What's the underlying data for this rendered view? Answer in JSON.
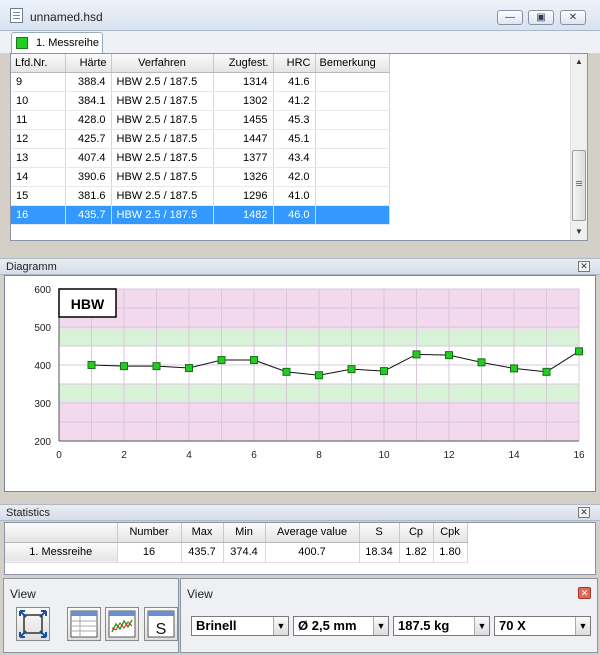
{
  "window": {
    "title": "unnamed.hsd",
    "minimize": "—",
    "restore": "▣",
    "close": "✕"
  },
  "tabs": [
    {
      "label": "1. Messreihe",
      "color": "#22cc22"
    }
  ],
  "grid": {
    "columns": [
      "Lfd.Nr.",
      "Härte",
      "Verfahren",
      "Zugfest.",
      "HRC",
      "Bemerkung"
    ],
    "rows": [
      [
        "9",
        "388.4",
        "HBW 2.5 / 187.5",
        "1314",
        "41.6",
        ""
      ],
      [
        "10",
        "384.1",
        "HBW 2.5 / 187.5",
        "1302",
        "41.2",
        ""
      ],
      [
        "11",
        "428.0",
        "HBW 2.5 / 187.5",
        "1455",
        "45.3",
        ""
      ],
      [
        "12",
        "425.7",
        "HBW 2.5 / 187.5",
        "1447",
        "45.1",
        ""
      ],
      [
        "13",
        "407.4",
        "HBW 2.5 / 187.5",
        "1377",
        "43.4",
        ""
      ],
      [
        "14",
        "390.6",
        "HBW 2.5 / 187.5",
        "1326",
        "42.0",
        ""
      ],
      [
        "15",
        "381.6",
        "HBW 2.5 / 187.5",
        "1296",
        "41.0",
        ""
      ],
      [
        "16",
        "435.7",
        "HBW 2.5 / 187.5",
        "1482",
        "46.0",
        ""
      ]
    ],
    "selected_row": "16"
  },
  "diagram": {
    "panel_title": "Diagramm",
    "close": "✕"
  },
  "chart_data": {
    "type": "line",
    "title": "HBW",
    "x": [
      1,
      2,
      3,
      4,
      5,
      6,
      7,
      8,
      9,
      10,
      11,
      12,
      13,
      14,
      15,
      16
    ],
    "series": [
      {
        "values": [
          400,
          397,
          397,
          392,
          413,
          413,
          382,
          373,
          389,
          384,
          428,
          426,
          407,
          391,
          382,
          436
        ]
      }
    ],
    "xlim": [
      0,
      16
    ],
    "ylim": [
      200,
      600
    ],
    "xticks": [
      0,
      2,
      4,
      6,
      8,
      10,
      12,
      14,
      16
    ],
    "yticks": [
      200,
      300,
      400,
      500,
      600
    ],
    "bands": [
      {
        "from": 200,
        "to": 300,
        "color": "#f2d9ee"
      },
      {
        "from": 300,
        "to": 350,
        "color": "#f2d9ee"
      },
      {
        "from": 305,
        "to": 350,
        "color": "#d7f2d7"
      },
      {
        "from": 450,
        "to": 495,
        "color": "#d7f2d7"
      },
      {
        "from": 495,
        "to": 600,
        "color": "#f2d9ee"
      }
    ],
    "grid": true,
    "marker_color": "#22cc22"
  },
  "statistics": {
    "panel_title": "Statistics",
    "close": "✕",
    "columns": [
      "",
      "Number",
      "Max",
      "Min",
      "Average value",
      "S",
      "Cp",
      "Cpk"
    ],
    "rows": [
      [
        "1. Messreihe",
        "16",
        "435.7",
        "374.4",
        "400.7",
        "18.34",
        "1.82",
        "1.80"
      ]
    ]
  },
  "view_left": {
    "title": "View",
    "buttons": [
      "fit-view-icon",
      "table-view-icon",
      "chart-view-icon",
      "statistics-view-icon"
    ],
    "stats_glyph": "S"
  },
  "view_right": {
    "title": "View",
    "close": "✕",
    "dropdowns": [
      {
        "name": "method-select",
        "value": "Brinell"
      },
      {
        "name": "ball-diameter-select",
        "value": "Ø 2,5 mm"
      },
      {
        "name": "load-select",
        "value": "187.5 kg"
      },
      {
        "name": "magnification-select",
        "value": "70 X"
      }
    ]
  }
}
